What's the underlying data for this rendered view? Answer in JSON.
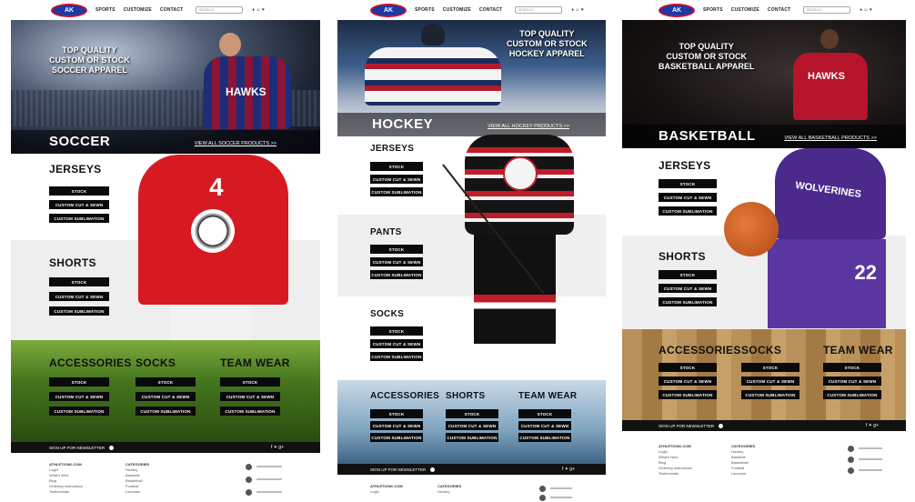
{
  "nav": {
    "logo": "AK",
    "links": [
      "SPORTS",
      "CUSTOMIZE",
      "CONTACT"
    ],
    "search_placeholder": "SEARCH",
    "misc": "♦ ☺ ♥"
  },
  "soccer": {
    "tagline": [
      "TOP QUALITY",
      "CUSTOM OR STOCK",
      "SOCCER APPAREL"
    ],
    "sport": "SOCCER",
    "view_all": "VIEW ALL SOCCER PRODUCTS >>",
    "jersey_text": "HAWKS",
    "jersey_number": "4",
    "sections": [
      {
        "title": "JERSEYS"
      },
      {
        "title": "SHORTS"
      }
    ],
    "bottom_sections": [
      {
        "title": "ACCESSORIES"
      },
      {
        "title": "SOCKS"
      },
      {
        "title": "TEAM WEAR"
      }
    ]
  },
  "hockey": {
    "tagline": [
      "TOP QUALITY",
      "CUSTOM OR STOCK",
      "HOCKEY APPAREL"
    ],
    "sport": "HOCKEY",
    "view_all": "VIEW ALL HOCKEY PRODUCTS >>",
    "sections": [
      {
        "title": "JERSEYS"
      },
      {
        "title": "PANTS"
      },
      {
        "title": "SOCKS"
      }
    ],
    "bottom_sections": [
      {
        "title": "ACCESSORIES"
      },
      {
        "title": "SHORTS"
      },
      {
        "title": "TEAM WEAR"
      }
    ]
  },
  "basketball": {
    "tagline": [
      "TOP QUALITY",
      "CUSTOM OR STOCK",
      "BASKETBALL APPAREL"
    ],
    "sport": "BASKETBALL",
    "view_all": "VIEW ALL BASKETBALL PRODUCTS >>",
    "jersey_text": "HAWKS",
    "jersey_text_2": "WOLVERINES",
    "jersey_number": "22",
    "sections": [
      {
        "title": "JERSEYS"
      },
      {
        "title": "SHORTS"
      }
    ],
    "bottom_sections": [
      {
        "title": "ACCESSORIES"
      },
      {
        "title": "SOCKS"
      },
      {
        "title": "TEAM WEAR"
      }
    ]
  },
  "buttons": {
    "stock": "STOCK",
    "cut_sew": "CUSTOM CUT & SEWN",
    "sublimation": "CUSTOM SUBLIMATION"
  },
  "newsletter": {
    "label": "SIGN UP FOR NEWSLETTER",
    "social": "f ✦ g+"
  },
  "footer": {
    "col1_head": "ATHLETICNK.COM",
    "col2_head": "CATEGORIES",
    "col1_items": [
      "Login",
      "What's New",
      "Blog",
      "Ordering Instructions",
      "Testimonials"
    ],
    "col2_items": [
      "Hockey",
      "Baseball",
      "Basketball",
      "Football",
      "Lacrosse"
    ]
  },
  "colors": {
    "button_bg": "#0a0a0a",
    "logo_blue": "#1a3aa8",
    "logo_red": "#c8102e"
  }
}
